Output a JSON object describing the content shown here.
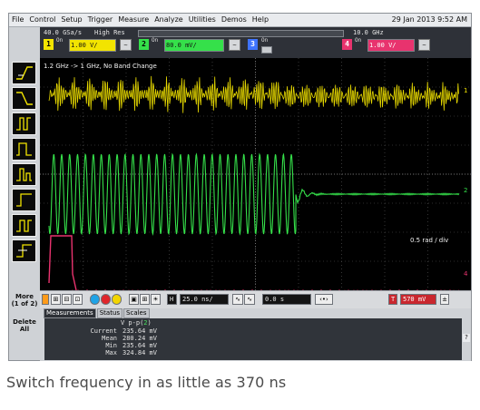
{
  "menu": {
    "items": [
      "File",
      "Control",
      "Setup",
      "Trigger",
      "Measure",
      "Analyze",
      "Utilities",
      "Demos",
      "Help"
    ],
    "datetime": "29 Jan 2013  9:52 AM"
  },
  "status": {
    "sample_rate": "40.0 GSa/s",
    "acq_mode": "High Res",
    "bandwidth": "10.0 GHz"
  },
  "channels": [
    {
      "num": "1",
      "on": "On",
      "scale": "1.00 V/",
      "color": "#f2e400"
    },
    {
      "num": "2",
      "on": "On",
      "scale": "80.0 mV/",
      "color": "#35e04a"
    },
    {
      "num": "3",
      "on": "On",
      "scale": "",
      "color": "#3f74ff"
    },
    {
      "num": "4",
      "on": "On",
      "scale": "1.00 V/",
      "color": "#e8336e"
    }
  ],
  "display": {
    "annotation": "1.2 GHz -> 1 GHz, No Band Change",
    "scale_note": "0.5 rad / div",
    "markers": {
      "ch1": "1",
      "ch2": "2",
      "ch4": "4"
    }
  },
  "left_panel": {
    "more_label": "More",
    "more_sub": "(1 of 2)",
    "delete_label": "Delete",
    "delete_sub": "All"
  },
  "controls": {
    "timebase": "25.0 ns/",
    "position": "0.0 s",
    "trigger_level": "570 mV",
    "horiz_label": "H",
    "trig_label": "T"
  },
  "measurements": {
    "tabs": [
      "Measurements",
      "Status",
      "Scales"
    ],
    "header": "V p-p(",
    "header_ch": "2",
    "header_end": ")",
    "rows": [
      {
        "label": "Current",
        "value": "235.64 mV"
      },
      {
        "label": "Mean",
        "value": "280.24 mV"
      },
      {
        "label": "Min",
        "value": "235.64 mV"
      },
      {
        "label": "Max",
        "value": "324.84 mV"
      }
    ],
    "help": "?"
  },
  "caption": "Switch frequency in as little as 370 ns",
  "colors": {
    "ch1": "#f2e400",
    "ch2": "#35e04a",
    "ch4": "#e8336e",
    "grid": "#5a5a5a",
    "accent_red": "#c9272e"
  }
}
